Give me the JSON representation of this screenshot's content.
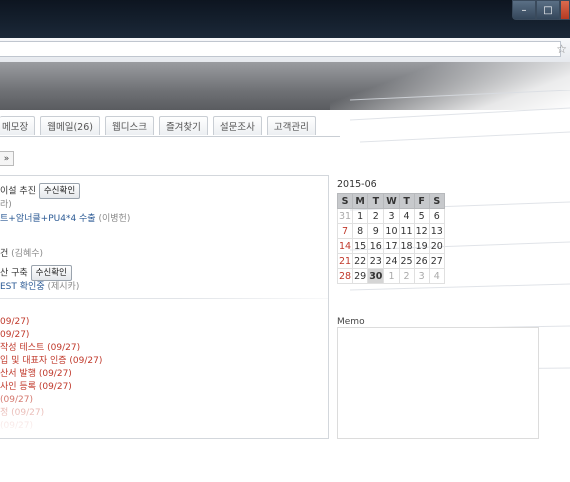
{
  "window": {
    "min_icon": "minimize-icon",
    "max_icon": "maximize-icon",
    "close_icon": "close-icon"
  },
  "toolbar": {
    "star_icon": "star-icon"
  },
  "tabs": [
    {
      "label": "메모장"
    },
    {
      "label": "웹메일(26)"
    },
    {
      "label": "웹디스크"
    },
    {
      "label": "즐겨찾기"
    },
    {
      "label": "설문조사"
    },
    {
      "label": "고객관리"
    }
  ],
  "nav": {
    "next_label": "»"
  },
  "approvals": {
    "row1_title": "이설 추진",
    "row1_button": "수신확인",
    "row1_sub": "라)",
    "row2_title": "트+암너클+PU4*4 수출",
    "row2_person": "(이병헌)",
    "row3_title": "건",
    "row3_person": "(김혜수)",
    "row4_title": "산 구축",
    "row4_button": "수신확인",
    "row5_title": "EST 확인중",
    "row5_person": "(제시카)"
  },
  "tasks": [
    {
      "text": "09/27)"
    },
    {
      "text": "09/27)"
    },
    {
      "text": "작성 테스트  (09/27)"
    },
    {
      "text": "입 및 대표자 인증  (09/27)"
    },
    {
      "text": "산서 발행 (09/27)"
    },
    {
      "text": "사인 등록 (09/27)"
    },
    {
      "text": "(09/27)"
    },
    {
      "text": "정 (09/27)"
    },
    {
      "text": "(09/27)"
    }
  ],
  "calendar": {
    "title": "2015-06",
    "headers": [
      "S",
      "M",
      "T",
      "W",
      "T",
      "F",
      "S"
    ],
    "weeks": [
      [
        "31",
        "1",
        "2",
        "3",
        "4",
        "5",
        "6"
      ],
      [
        "7",
        "8",
        "9",
        "10",
        "11",
        "12",
        "13"
      ],
      [
        "14",
        "15",
        "16",
        "17",
        "18",
        "19",
        "20"
      ],
      [
        "21",
        "22",
        "23",
        "24",
        "25",
        "26",
        "27"
      ],
      [
        "28",
        "29",
        "30",
        "1",
        "2",
        "3",
        "4"
      ]
    ]
  },
  "memo": {
    "label": "Memo"
  },
  "colors": {
    "accent_red": "#c0392b",
    "link_blue": "#2b5a94",
    "titlebar": "#0d1520"
  }
}
